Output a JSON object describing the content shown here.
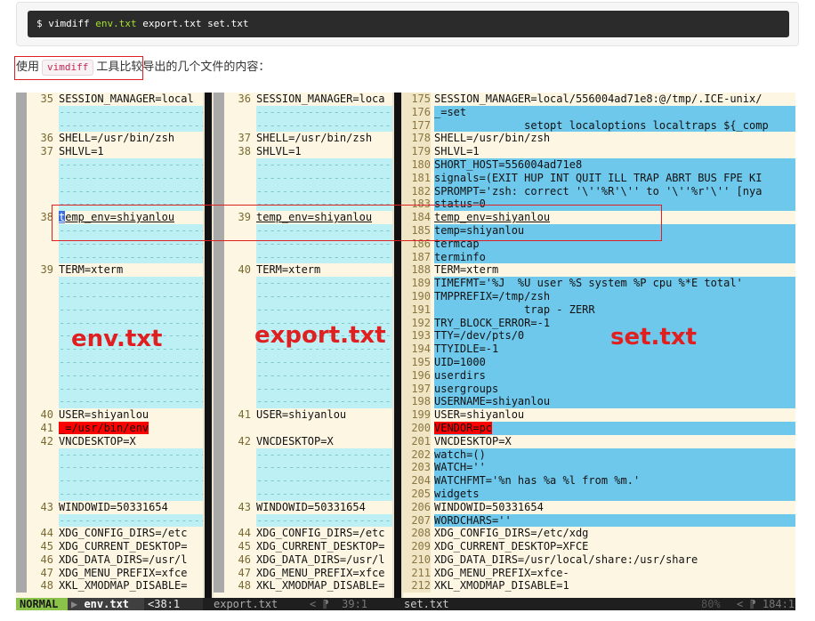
{
  "command": {
    "prompt": "$",
    "prog": "vimdiff",
    "file1": "env.txt",
    "file2": "export.txt",
    "file3": "set.txt"
  },
  "description": {
    "before": "使用",
    "code": "vimdiff",
    "after": "工具比较导出的几个文件的内容："
  },
  "labels": {
    "env": "env.txt",
    "export": "export.txt",
    "set": "set.txt"
  },
  "panes": [
    {
      "name": "env",
      "lines": [
        {
          "t": "n",
          "ln": "35",
          "tx": "SESSION_MANAGER=local"
        },
        {
          "t": "f"
        },
        {
          "t": "f"
        },
        {
          "t": "n",
          "ln": "36",
          "tx": "SHELL=/usr/bin/zsh"
        },
        {
          "t": "n",
          "ln": "37",
          "tx": "SHLVL=1"
        },
        {
          "t": "f"
        },
        {
          "t": "f"
        },
        {
          "t": "f"
        },
        {
          "t": "f"
        },
        {
          "t": "n",
          "ln": "38",
          "tx": "temp_env=shiyanlou",
          "style": "cursor"
        },
        {
          "t": "f"
        },
        {
          "t": "f"
        },
        {
          "t": "f"
        },
        {
          "t": "n",
          "ln": "39",
          "tx": "TERM=xterm"
        },
        {
          "t": "f"
        },
        {
          "t": "f"
        },
        {
          "t": "f"
        },
        {
          "t": "f"
        },
        {
          "t": "f"
        },
        {
          "t": "f"
        },
        {
          "t": "f"
        },
        {
          "t": "f"
        },
        {
          "t": "f"
        },
        {
          "t": "f"
        },
        {
          "t": "n",
          "ln": "40",
          "tx": "USER=shiyanlou"
        },
        {
          "t": "n",
          "ln": "41",
          "tx": "_=/usr/bin/env",
          "style": "red"
        },
        {
          "t": "n",
          "ln": "42",
          "tx": "VNCDESKTOP=X"
        },
        {
          "t": "f"
        },
        {
          "t": "f"
        },
        {
          "t": "f"
        },
        {
          "t": "f"
        },
        {
          "t": "n",
          "ln": "43",
          "tx": "WINDOWID=50331654"
        },
        {
          "t": "f"
        },
        {
          "t": "n",
          "ln": "44",
          "tx": "XDG_CONFIG_DIRS=/etc"
        },
        {
          "t": "n",
          "ln": "45",
          "tx": "XDG_CURRENT_DESKTOP="
        },
        {
          "t": "n",
          "ln": "46",
          "tx": "XDG_DATA_DIRS=/usr/l"
        },
        {
          "t": "n",
          "ln": "47",
          "tx": "XDG_MENU_PREFIX=xfce"
        },
        {
          "t": "n",
          "ln": "48",
          "tx": "XKL_XMODMAP_DISABLE="
        }
      ]
    },
    {
      "name": "export",
      "lines": [
        {
          "t": "n",
          "ln": "36",
          "tx": "SESSION_MANAGER=loca"
        },
        {
          "t": "f"
        },
        {
          "t": "f"
        },
        {
          "t": "n",
          "ln": "37",
          "tx": "SHELL=/usr/bin/zsh"
        },
        {
          "t": "n",
          "ln": "38",
          "tx": "SHLVL=1"
        },
        {
          "t": "f"
        },
        {
          "t": "f"
        },
        {
          "t": "f"
        },
        {
          "t": "f"
        },
        {
          "t": "n",
          "ln": "39",
          "tx": "temp_env=shiyanlou",
          "style": "under"
        },
        {
          "t": "f"
        },
        {
          "t": "f"
        },
        {
          "t": "f"
        },
        {
          "t": "n",
          "ln": "40",
          "tx": "TERM=xterm"
        },
        {
          "t": "f"
        },
        {
          "t": "f"
        },
        {
          "t": "f"
        },
        {
          "t": "f"
        },
        {
          "t": "f"
        },
        {
          "t": "f"
        },
        {
          "t": "f"
        },
        {
          "t": "f"
        },
        {
          "t": "f"
        },
        {
          "t": "f"
        },
        {
          "t": "n",
          "ln": "41",
          "tx": "USER=shiyanlou"
        },
        {
          "t": "d"
        },
        {
          "t": "n",
          "ln": "42",
          "tx": "VNCDESKTOP=X"
        },
        {
          "t": "f"
        },
        {
          "t": "f"
        },
        {
          "t": "f"
        },
        {
          "t": "f"
        },
        {
          "t": "n",
          "ln": "43",
          "tx": "WINDOWID=50331654"
        },
        {
          "t": "f"
        },
        {
          "t": "n",
          "ln": "44",
          "tx": "XDG_CONFIG_DIRS=/etc"
        },
        {
          "t": "n",
          "ln": "45",
          "tx": "XDG_CURRENT_DESKTOP="
        },
        {
          "t": "n",
          "ln": "46",
          "tx": "XDG_DATA_DIRS=/usr/l"
        },
        {
          "t": "n",
          "ln": "47",
          "tx": "XDG_MENU_PREFIX=xfce"
        },
        {
          "t": "n",
          "ln": "48",
          "tx": "XKL_XMODMAP_DISABLE="
        }
      ]
    },
    {
      "name": "set",
      "lines": [
        {
          "t": "n",
          "ln": "175",
          "tx": "SESSION_MANAGER=local/556004ad71e8:@/tmp/.ICE-unix/"
        },
        {
          "t": "a",
          "ln": "176",
          "tx": "_=set"
        },
        {
          "t": "a",
          "ln": "177",
          "tx": "              setopt localoptions localtraps ${_comp"
        },
        {
          "t": "n",
          "ln": "178",
          "tx": "SHELL=/usr/bin/zsh"
        },
        {
          "t": "n",
          "ln": "179",
          "tx": "SHLVL=1"
        },
        {
          "t": "a",
          "ln": "180",
          "tx": "SHORT_HOST=556004ad71e8"
        },
        {
          "t": "a",
          "ln": "181",
          "tx": "signals=(EXIT HUP INT QUIT ILL TRAP ABRT BUS FPE KI"
        },
        {
          "t": "a",
          "ln": "182",
          "tx": "SPROMPT='zsh: correct '\\''%R'\\'' to '\\''%r'\\'' [nya"
        },
        {
          "t": "a",
          "ln": "183",
          "tx": "status=0"
        },
        {
          "t": "n",
          "ln": "184",
          "tx": "temp_env=shiyanlou",
          "style": "under"
        },
        {
          "t": "a",
          "ln": "185",
          "tx": "temp=shiyanlou"
        },
        {
          "t": "a",
          "ln": "186",
          "tx": "termcap"
        },
        {
          "t": "a",
          "ln": "187",
          "tx": "terminfo"
        },
        {
          "t": "n",
          "ln": "188",
          "tx": "TERM=xterm"
        },
        {
          "t": "a",
          "ln": "189",
          "tx": "TIMEFMT='%J  %U user %S system %P cpu %*E total'"
        },
        {
          "t": "a",
          "ln": "190",
          "tx": "TMPPREFIX=/tmp/zsh"
        },
        {
          "t": "a",
          "ln": "191",
          "tx": "              trap - ZERR"
        },
        {
          "t": "a",
          "ln": "192",
          "tx": "TRY_BLOCK_ERROR=-1"
        },
        {
          "t": "a",
          "ln": "193",
          "tx": "TTY=/dev/pts/0"
        },
        {
          "t": "a",
          "ln": "194",
          "tx": "TTYIDLE=-1"
        },
        {
          "t": "a",
          "ln": "195",
          "tx": "UID=1000"
        },
        {
          "t": "a",
          "ln": "196",
          "tx": "userdirs"
        },
        {
          "t": "a",
          "ln": "197",
          "tx": "usergroups"
        },
        {
          "t": "a",
          "ln": "198",
          "tx": "USERNAME=shiyanlou"
        },
        {
          "t": "n",
          "ln": "199",
          "tx": "USER=shiyanlou"
        },
        {
          "t": "x",
          "ln": "200",
          "tx": "VENDOR=pc",
          "style": "red"
        },
        {
          "t": "n",
          "ln": "201",
          "tx": "VNCDESKTOP=X"
        },
        {
          "t": "a",
          "ln": "202",
          "tx": "watch=()"
        },
        {
          "t": "a",
          "ln": "203",
          "tx": "WATCH=''"
        },
        {
          "t": "a",
          "ln": "204",
          "tx": "WATCHFMT='%n has %a %l from %m.'"
        },
        {
          "t": "a",
          "ln": "205",
          "tx": "widgets"
        },
        {
          "t": "n",
          "ln": "206",
          "tx": "WINDOWID=50331654"
        },
        {
          "t": "a",
          "ln": "207",
          "tx": "WORDCHARS=''"
        },
        {
          "t": "n",
          "ln": "208",
          "tx": "XDG_CONFIG_DIRS=/etc/xdg"
        },
        {
          "t": "n",
          "ln": "209",
          "tx": "XDG_CURRENT_DESKTOP=XFCE"
        },
        {
          "t": "n",
          "ln": "210",
          "tx": "XDG_DATA_DIRS=/usr/local/share:/usr/share"
        },
        {
          "t": "n",
          "ln": "211",
          "tx": "XDG_MENU_PREFIX=xfce-"
        },
        {
          "t": "n",
          "ln": "212",
          "tx": "XKL_XMODMAP_DISABLE=1"
        }
      ]
    }
  ],
  "statusbar": {
    "mode": "NORMAL",
    "file1": "env.txt",
    "pos1": "<38:1",
    "file2": "export.txt",
    "pos2": "< ⁋  39:1",
    "file3": "set.txt",
    "pct3": "80%",
    "pos3": "< ⁋ 184:1"
  }
}
